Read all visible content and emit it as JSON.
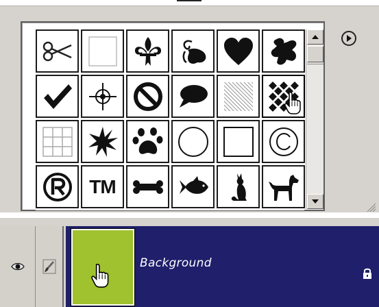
{
  "shape_picker": {
    "rows": [
      [
        "scissors",
        "blank-frame",
        "fleur-de-lis",
        "ornament",
        "heart",
        "puzzle-piece"
      ],
      [
        "checkmark",
        "target",
        "no-symbol",
        "speech-bubble",
        "diagonal-lines",
        "diamond-pattern"
      ],
      [
        "grid",
        "starburst",
        "paw-print",
        "circle",
        "square",
        "copyright"
      ],
      [
        "registered",
        "trademark",
        "bone",
        "fish",
        "cat",
        "dog"
      ]
    ],
    "selected": "diamond-pattern",
    "tm_text": "TM"
  },
  "layers": {
    "layer_name": "Background",
    "thumbnail_color": "#9fc22e",
    "panel_color": "#1f1f6b"
  },
  "colors": {
    "panel_bg": "#d6d3ce",
    "grid_border": "#1a1a1a"
  }
}
